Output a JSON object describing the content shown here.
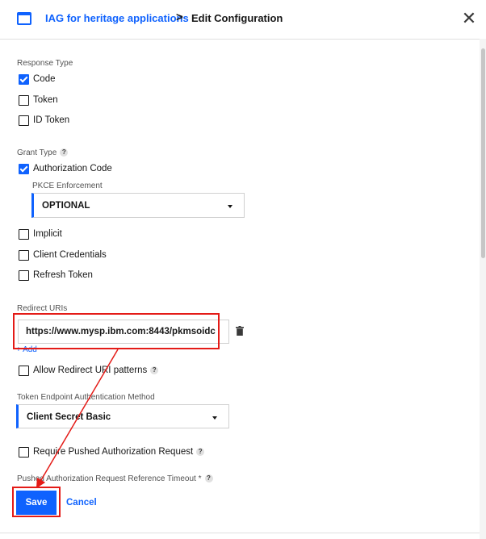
{
  "header": {
    "breadcrumb_link": "IAG for heritage applications",
    "breadcrumb_separator": ">",
    "title": "Edit Configuration",
    "close_icon": "close-icon"
  },
  "response_type": {
    "label": "Response Type",
    "options": [
      {
        "label": "Code",
        "checked": true
      },
      {
        "label": "Token",
        "checked": false
      },
      {
        "label": "ID Token",
        "checked": false
      }
    ]
  },
  "grant_type": {
    "label": "Grant Type",
    "help": "?",
    "authorization_code": {
      "label": "Authorization Code",
      "checked": true
    },
    "pkce": {
      "label": "PKCE Enforcement",
      "value": "OPTIONAL"
    },
    "implicit": {
      "label": "Implicit",
      "checked": false
    },
    "client_credentials": {
      "label": "Client Credentials",
      "checked": false
    },
    "refresh_token": {
      "label": "Refresh Token",
      "checked": false
    }
  },
  "redirect": {
    "label": "Redirect URIs",
    "uri_value": "https://www.mysp.ibm.com:8443/pkmsoidc",
    "add_label": "+ Add",
    "allow_patterns": {
      "label": "Allow Redirect URI patterns",
      "checked": false
    },
    "help": "?"
  },
  "token_endpoint": {
    "label": "Token Endpoint Authentication Method",
    "value": "Client Secret Basic"
  },
  "par": {
    "require": {
      "label": "Require Pushed Authorization Request",
      "checked": false
    },
    "help": "?",
    "timeout_label": "Pushed Authorization Request Reference Timeout",
    "required_mark": "*",
    "timeout_help": "?"
  },
  "actions": {
    "save_label": "Save",
    "cancel_label": "Cancel"
  },
  "colors": {
    "accent": "#0f62fe",
    "annotation": "#e41b17"
  }
}
